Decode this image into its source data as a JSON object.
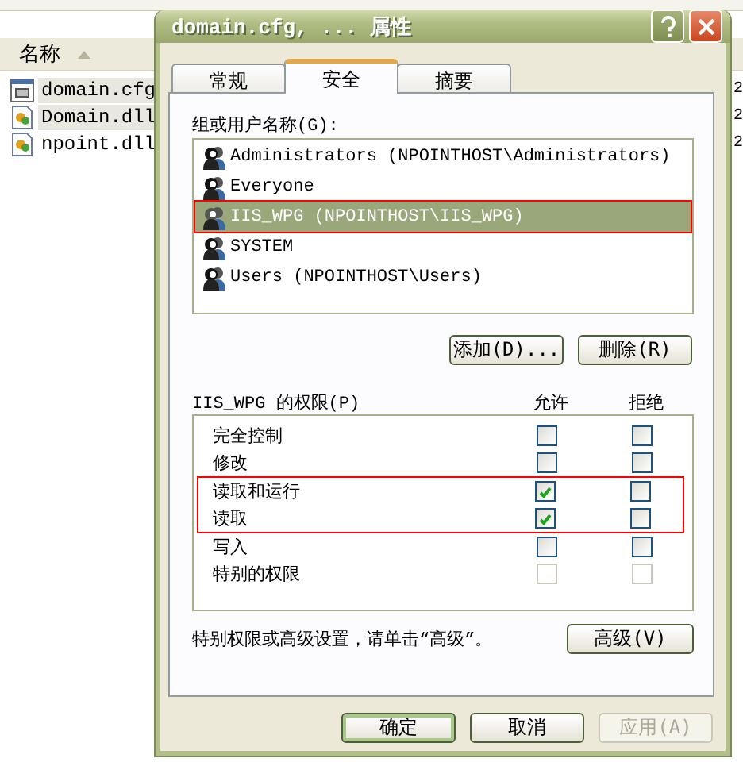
{
  "explorer": {
    "column_header": "名称",
    "files": [
      {
        "name": "domain.cfg",
        "kind": "config",
        "selected": true,
        "column_2": "2"
      },
      {
        "name": "Domain.dll",
        "kind": "library",
        "selected": true,
        "column_2": "2"
      },
      {
        "name": "npoint.dll",
        "kind": "library",
        "selected": false,
        "column_2": "2"
      }
    ]
  },
  "dialog": {
    "title": "domain.cfg, ... 属性",
    "tabs": [
      {
        "label": "常规",
        "selected": false
      },
      {
        "label": "安全",
        "selected": true
      },
      {
        "label": "摘要",
        "selected": false
      }
    ],
    "group_label": "组或用户名称(G):",
    "users": [
      {
        "name": "Administrators (NPOINTHOST\\Administrators)",
        "selected": false,
        "highlighted": false
      },
      {
        "name": "Everyone",
        "selected": false,
        "highlighted": false
      },
      {
        "name": "IIS_WPG (NPOINTHOST\\IIS_WPG)",
        "selected": true,
        "highlighted": true
      },
      {
        "name": "SYSTEM",
        "selected": false,
        "highlighted": false
      },
      {
        "name": "Users (NPOINTHOST\\Users)",
        "selected": false,
        "highlighted": false
      }
    ],
    "user_buttons": [
      "添加(D)...",
      "删除(R)"
    ],
    "permissions_label": "IIS_WPG 的权限(P)",
    "columns": [
      "允许",
      "拒绝"
    ],
    "permissions": [
      {
        "name": "完全控制",
        "allow": false,
        "deny": false,
        "disabled": false,
        "highlighted": false
      },
      {
        "name": "修改",
        "allow": false,
        "deny": false,
        "disabled": false,
        "highlighted": false
      },
      {
        "name": "读取和运行",
        "allow": true,
        "deny": false,
        "disabled": false,
        "highlighted": true
      },
      {
        "name": "读取",
        "allow": true,
        "deny": false,
        "disabled": false,
        "highlighted": true
      },
      {
        "name": "写入",
        "allow": false,
        "deny": false,
        "disabled": false,
        "highlighted": false
      },
      {
        "name": "特别的权限",
        "allow": false,
        "deny": false,
        "disabled": true,
        "highlighted": false
      }
    ],
    "note": "特别权限或高级设置，请单击“高级”。",
    "advanced_button": "高级(V)",
    "footer_buttons": [
      {
        "label": "确定",
        "default": true,
        "disabled": false
      },
      {
        "label": "取消",
        "default": false,
        "disabled": false
      },
      {
        "label": "应用(A)",
        "default": false,
        "disabled": true
      }
    ]
  }
}
